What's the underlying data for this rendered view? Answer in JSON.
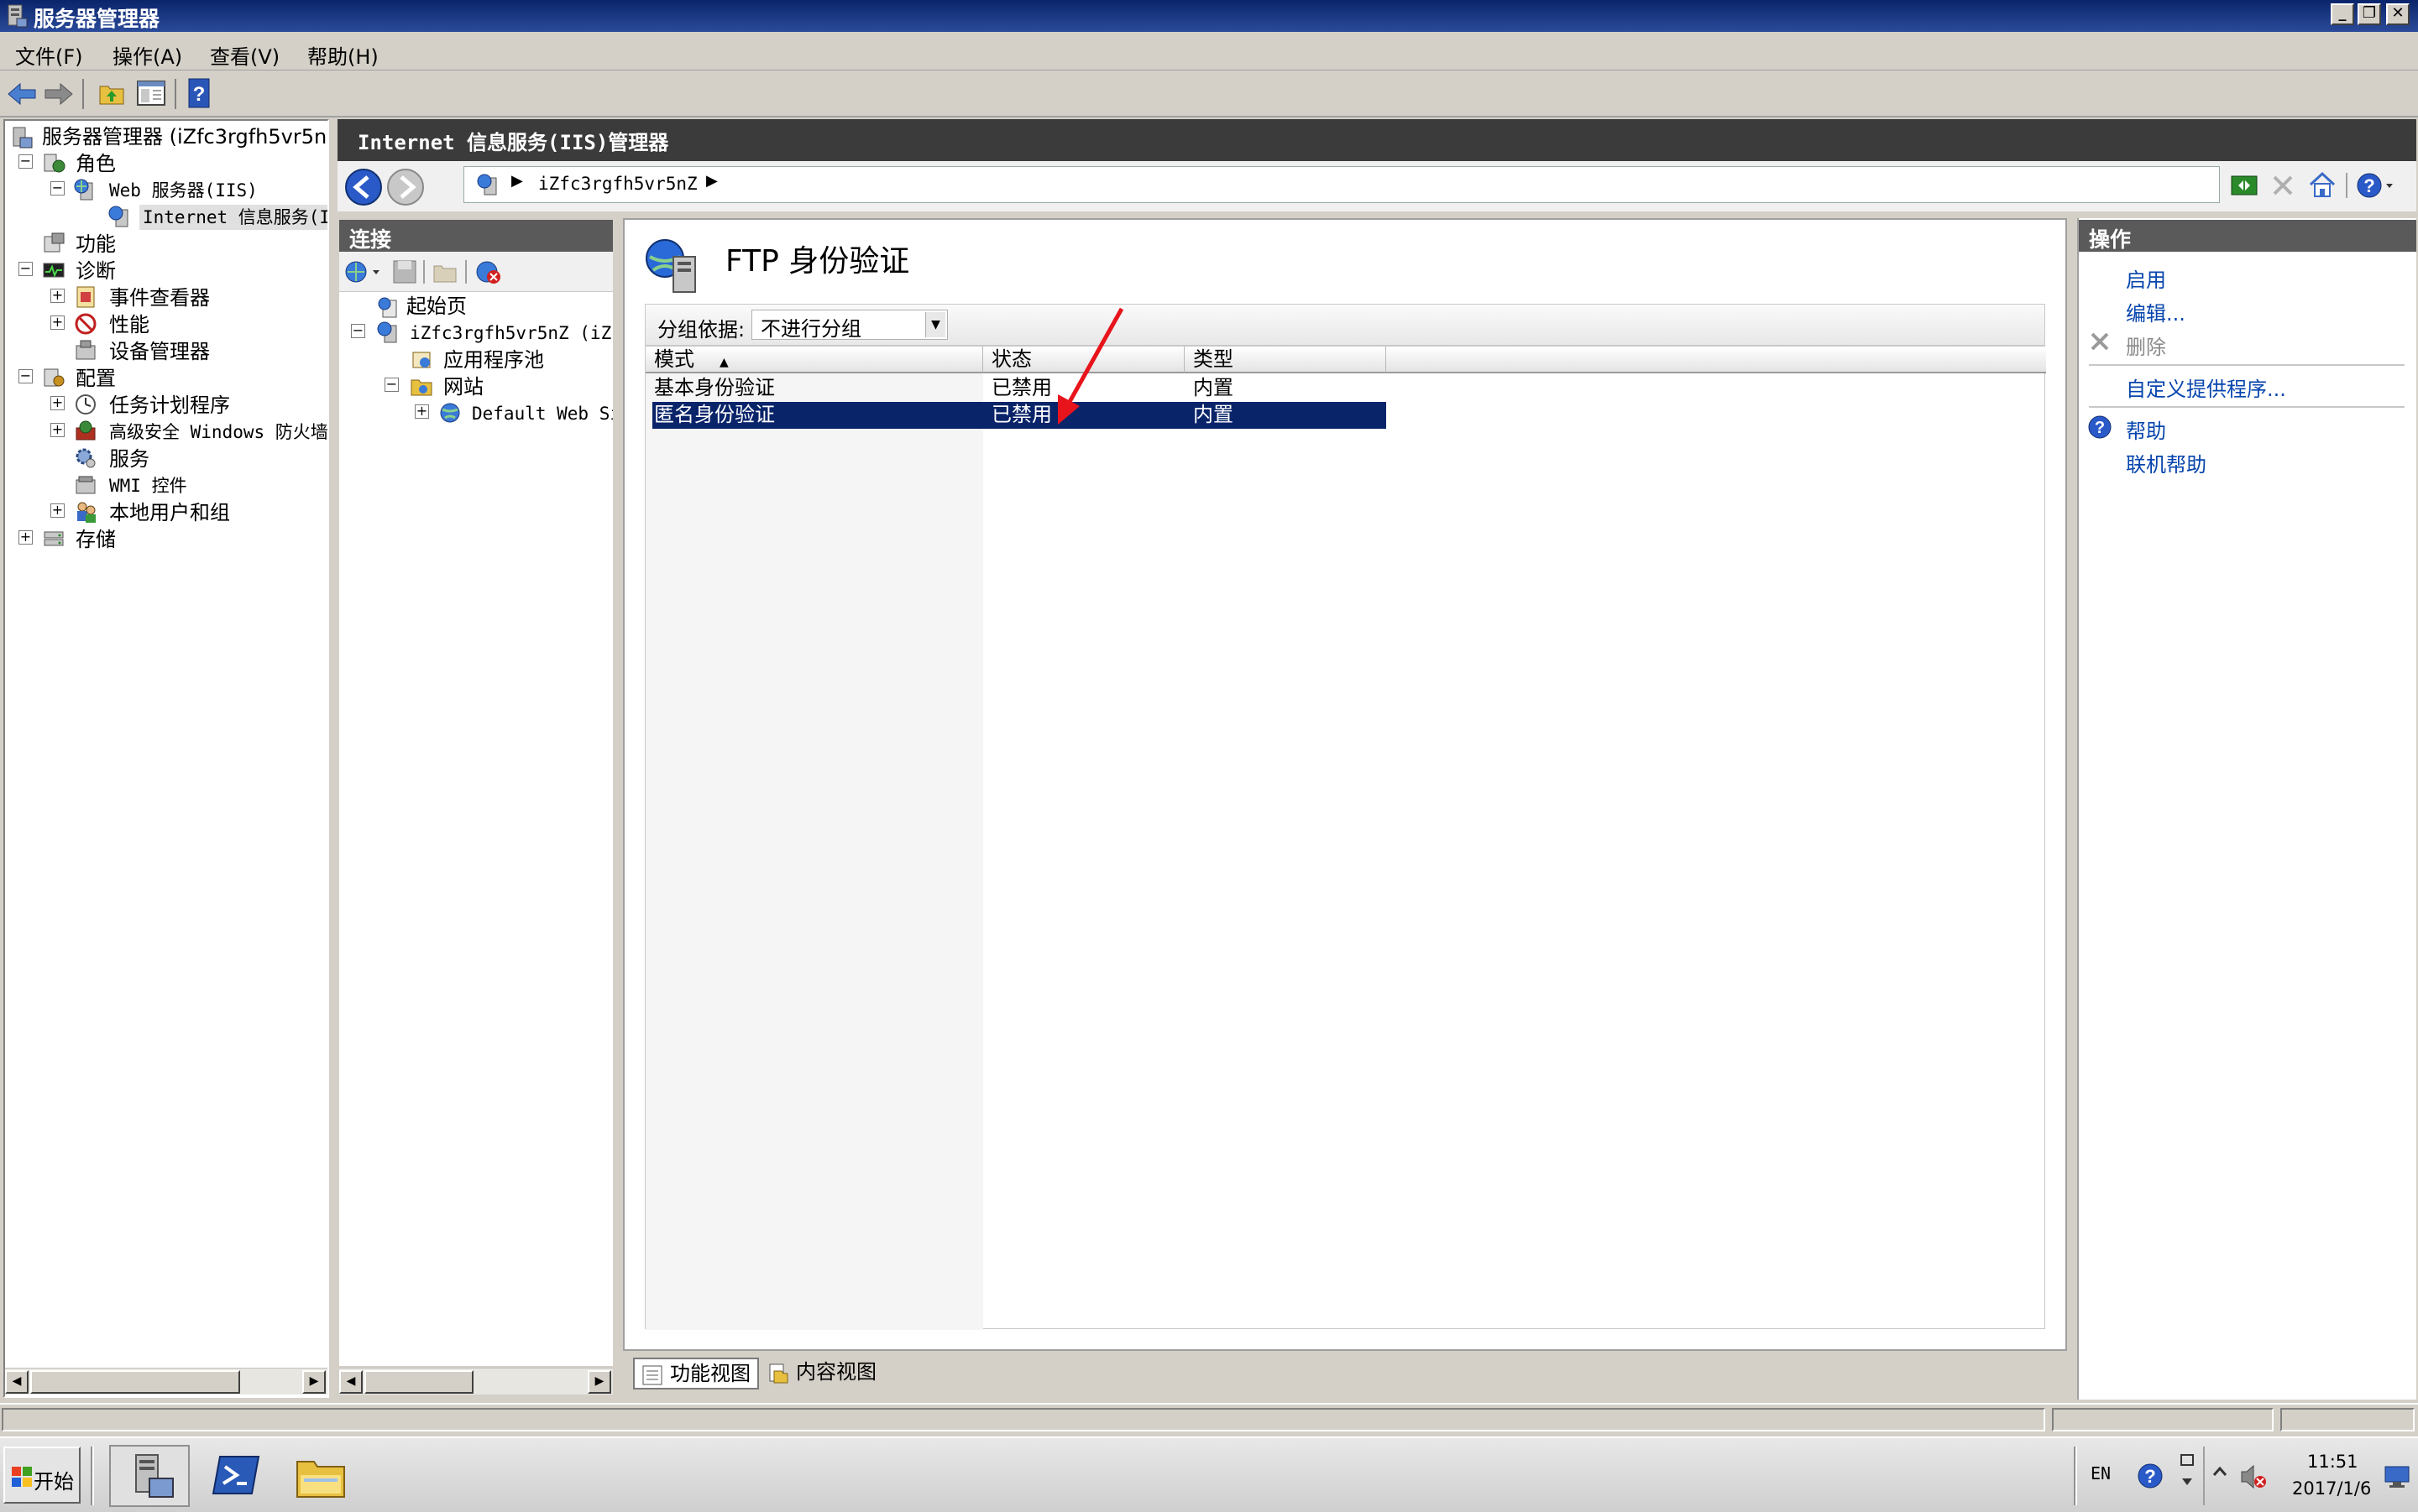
{
  "window": {
    "title": "服务器管理器"
  },
  "menu": [
    {
      "label": "文件(F)"
    },
    {
      "label": "操作(A)"
    },
    {
      "label": "查看(V)"
    },
    {
      "label": "帮助(H)"
    }
  ],
  "tree": {
    "root": "服务器管理器 (iZfc3rgfh5vr5n",
    "roles": "角色",
    "web_server": "Web 服务器(IIS)",
    "iis_manager": "Internet 信息服务(I",
    "features": "功能",
    "diagnostics": "诊断",
    "event_viewer": "事件查看器",
    "performance": "性能",
    "device_manager": "设备管理器",
    "configuration": "配置",
    "task_scheduler": "任务计划程序",
    "firewall": "高级安全 Windows 防火墙",
    "services": "服务",
    "wmi": "WMI 控件",
    "local_users": "本地用户和组",
    "storage": "存储"
  },
  "iis": {
    "header": "Internet 信息服务(IIS)管理器",
    "address": "iZfc3rgfh5vr5nZ"
  },
  "connections": {
    "title": "连接",
    "start_page": "起始页",
    "server": "iZfc3rgfh5vr5nZ (iZf",
    "app_pools": "应用程序池",
    "sites": "网站",
    "default_site": "Default Web Si"
  },
  "feature": {
    "title": "FTP 身份验证",
    "group_by_label": "分组依据:",
    "group_by_value": "不进行分组",
    "columns": [
      "模式",
      "状态",
      "类型"
    ],
    "rows": [
      {
        "mode": "基本身份验证",
        "status": "已禁用",
        "type": "内置"
      },
      {
        "mode": "匿名身份验证",
        "status": "已禁用",
        "type": "内置"
      }
    ]
  },
  "view_tabs": {
    "features_view": "功能视图",
    "content_view": "内容视图"
  },
  "actions": {
    "title": "操作",
    "enable": "启用",
    "edit": "编辑...",
    "delete": "删除",
    "custom_providers": "自定义提供程序...",
    "help": "帮助",
    "online_help": "联机帮助"
  },
  "taskbar": {
    "start": "开始",
    "lang": "EN",
    "time": "11:51",
    "date": "2017/1/6"
  },
  "colors": {
    "selection": "#0a246a",
    "title_bar": "#0a246a",
    "annotation_arrow": "#e8141c"
  }
}
